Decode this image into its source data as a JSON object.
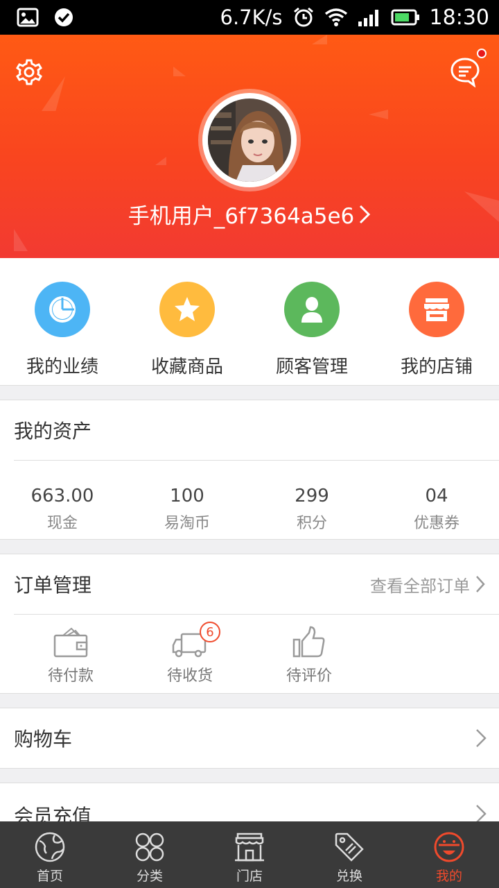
{
  "status_bar": {
    "net_speed": "6.7K/s",
    "time": "18:30"
  },
  "profile": {
    "username": "手机用户_6f7364a5e6"
  },
  "quick_menu": [
    {
      "label": "我的业绩",
      "color": "#4db5f5",
      "icon": "pie-chart-icon"
    },
    {
      "label": "收藏商品",
      "color": "#ffbb3e",
      "icon": "star-icon"
    },
    {
      "label": "顾客管理",
      "color": "#5cb85c",
      "icon": "person-icon"
    },
    {
      "label": "我的店铺",
      "color": "#ff6a3c",
      "icon": "store-icon"
    }
  ],
  "assets": {
    "title": "我的资产",
    "items": [
      {
        "value": "663.00",
        "label": "现金"
      },
      {
        "value": "100",
        "label": "易淘币"
      },
      {
        "value": "299",
        "label": "积分"
      },
      {
        "value": "04",
        "label": "优惠券"
      }
    ]
  },
  "orders": {
    "title": "订单管理",
    "view_all": "查看全部订单",
    "items": [
      {
        "label": "待付款",
        "icon": "wallet-icon"
      },
      {
        "label": "待收货",
        "icon": "truck-icon",
        "badge": "6"
      },
      {
        "label": "待评价",
        "icon": "thumbs-up-icon"
      }
    ]
  },
  "rows": {
    "cart": "购物车",
    "recharge": "会员充值"
  },
  "bottom_nav": [
    {
      "label": "首页",
      "icon": "globe-icon"
    },
    {
      "label": "分类",
      "icon": "grid-icon"
    },
    {
      "label": "门店",
      "icon": "shop-icon"
    },
    {
      "label": "兑换",
      "icon": "tag-icon"
    },
    {
      "label": "我的",
      "icon": "smile-icon",
      "active": true
    }
  ],
  "colors": {
    "accent": "#f04a2c",
    "header_top": "#ff5a14",
    "header_bottom": "#f23a32"
  }
}
